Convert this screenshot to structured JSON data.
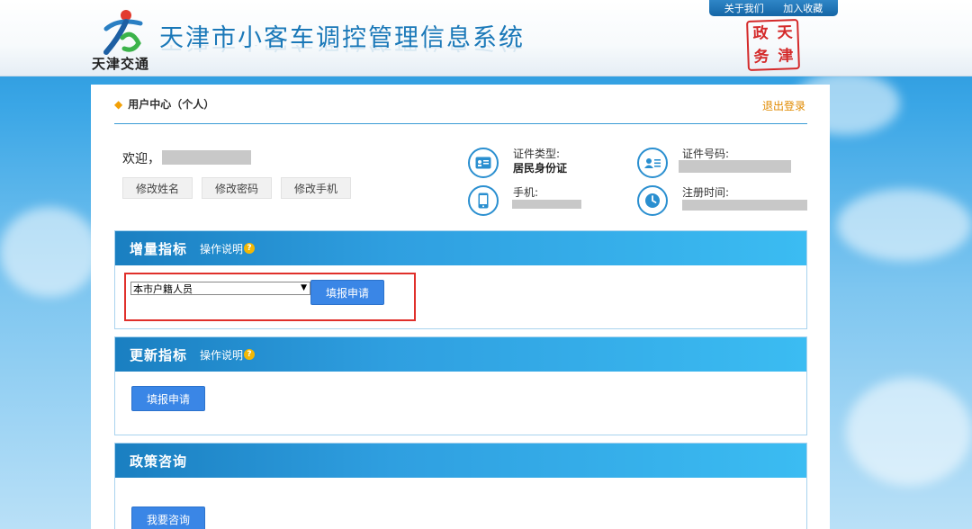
{
  "header": {
    "logo_text": "天津交通",
    "title": "天津市小客车调控管理信息系统",
    "top_links": [
      "关于我们",
      "加入收藏"
    ],
    "seal_chars": [
      "天",
      "津",
      "政",
      "务"
    ]
  },
  "user_center": {
    "breadcrumb": "用户中心（个人）",
    "logout": "退出登录",
    "welcome": "欢迎，",
    "actions": [
      "修改姓名",
      "修改密码",
      "修改手机"
    ],
    "id_type_label": "证件类型:",
    "id_type_value": "居民身份证",
    "id_number_label": "证件号码:",
    "phone_label": "手机:",
    "register_time_label": "注册时间:"
  },
  "sections": {
    "increment": {
      "title": "增量指标",
      "help": "操作说明",
      "select_value": "本市户籍人员",
      "submit": "填报申请"
    },
    "renewal": {
      "title": "更新指标",
      "help": "操作说明",
      "submit": "填报申请"
    },
    "policy": {
      "title": "政策咨询",
      "submit": "我要咨询"
    }
  },
  "colors": {
    "accent_blue": "#3a86e6",
    "section_header": "#2f9fe0",
    "highlight_red": "#e0302b",
    "logout_orange": "#e08a00"
  }
}
